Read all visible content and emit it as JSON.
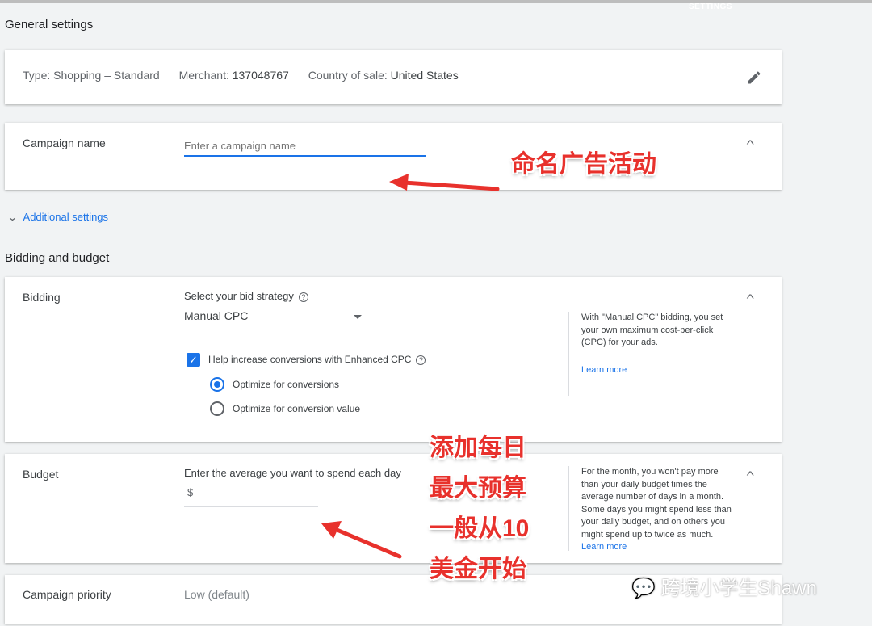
{
  "top": {
    "label": "SETTINGS"
  },
  "general": {
    "title": "General settings",
    "type_label": "Type:",
    "type_value": "Shopping – Standard",
    "merchant_label": "Merchant:",
    "merchant_value": "137048767",
    "country_label": "Country of sale:",
    "country_value": "United States"
  },
  "campaign_name": {
    "label": "Campaign name",
    "placeholder": "Enter a campaign name"
  },
  "additional": {
    "label": "Additional settings"
  },
  "bidding_section": {
    "title": "Bidding and budget"
  },
  "bidding": {
    "label": "Bidding",
    "strategy_label": "Select your bid strategy",
    "strategy_value": "Manual CPC",
    "ecpc_label": "Help increase conversions with Enhanced CPC",
    "ecpc_checked": true,
    "options": [
      {
        "label": "Optimize for conversions",
        "selected": true
      },
      {
        "label": "Optimize for conversion value",
        "selected": false
      }
    ],
    "help_text": "With \"Manual CPC\" bidding, you set your own maximum cost-per-click (CPC) for your ads.",
    "learn_more": "Learn more"
  },
  "budget": {
    "label": "Budget",
    "prompt": "Enter the average you want to spend each day",
    "currency": "$",
    "help_text": "For the month, you won't pay more than your daily budget times the average number of days in a month. Some days you might spend less than your daily budget, and on others you might spend up to twice as much.",
    "learn_more": "Learn more"
  },
  "priority": {
    "label": "Campaign priority",
    "value": "Low (default)"
  },
  "annotations": {
    "name_note": "命名广告活动",
    "budget_note": [
      "添加每日",
      "最大预算",
      "一般从10",
      "美金开始"
    ]
  },
  "watermark": "跨境小学生Shawn",
  "colors": {
    "accent": "#1a73e8",
    "annotation": "#e8312c",
    "background": "#f1f3f4"
  }
}
